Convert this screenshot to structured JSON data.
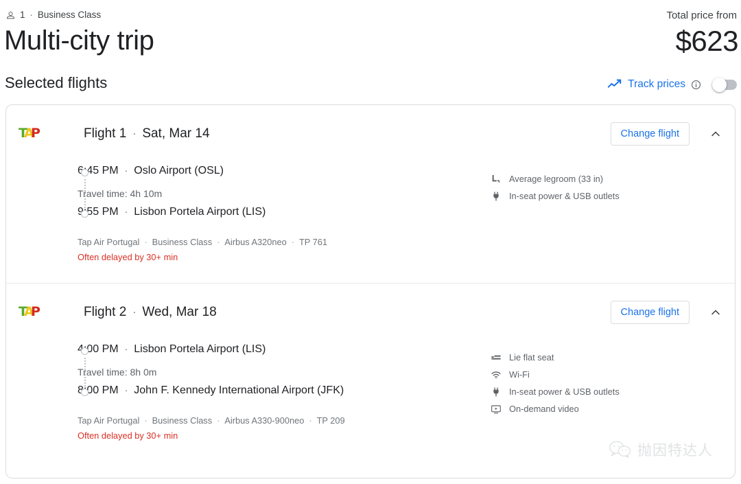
{
  "header": {
    "passenger_icon": "person-icon",
    "passenger_count": "1",
    "separator": "·",
    "cabin_class": "Business Class",
    "title": "Multi-city trip",
    "total_price_label": "Total price from",
    "total_price": "$623"
  },
  "section": {
    "heading": "Selected flights",
    "track_prices": {
      "trend_icon": "trending-up-icon",
      "label": "Track prices",
      "info_icon": "info-icon",
      "toggle_state": "off"
    }
  },
  "colors": {
    "accent_blue": "#1a73e8",
    "warning_red": "#d93025",
    "text_primary": "#202124",
    "text_secondary": "#5f6368",
    "border": "#dadce0",
    "toggle_track": "#bdc1c6",
    "tap_green": "#5aaa2d",
    "tap_yellow": "#f0c419",
    "tap_red": "#d32a1e"
  },
  "flights": [
    {
      "airline_logo": "tap-air-portugal-logo",
      "label": "Flight 1",
      "separator": "·",
      "date": "Sat, Mar 14",
      "change_button": "Change flight",
      "collapse_icon": "chevron-up-icon",
      "departure": {
        "time": "6:45 PM",
        "separator": "·",
        "airport": "Oslo Airport (OSL)"
      },
      "travel_time": "Travel time: 4h 10m",
      "arrival": {
        "time": "9:55 PM",
        "separator": "·",
        "airport": "Lisbon Portela Airport (LIS)"
      },
      "meta": [
        "Tap Air Portugal",
        "Business Class",
        "Airbus A320neo",
        "TP 761"
      ],
      "delay_note": "Often delayed by 30+ min",
      "amenities": [
        {
          "icon": "legroom-icon",
          "label": "Average legroom (33 in)"
        },
        {
          "icon": "power-plug-icon",
          "label": "In-seat power & USB outlets"
        }
      ]
    },
    {
      "airline_logo": "tap-air-portugal-logo",
      "label": "Flight 2",
      "separator": "·",
      "date": "Wed, Mar 18",
      "change_button": "Change flight",
      "collapse_icon": "chevron-up-icon",
      "departure": {
        "time": "4:00 PM",
        "separator": "·",
        "airport": "Lisbon Portela Airport (LIS)"
      },
      "travel_time": "Travel time: 8h 0m",
      "arrival": {
        "time": "8:00 PM",
        "separator": "·",
        "airport": "John F. Kennedy International Airport (JFK)"
      },
      "meta": [
        "Tap Air Portugal",
        "Business Class",
        "Airbus A330-900neo",
        "TP 209"
      ],
      "delay_note": "Often delayed by 30+ min",
      "amenities": [
        {
          "icon": "lie-flat-seat-icon",
          "label": "Lie flat seat"
        },
        {
          "icon": "wifi-icon",
          "label": "Wi-Fi"
        },
        {
          "icon": "power-plug-icon",
          "label": "In-seat power & USB outlets"
        },
        {
          "icon": "on-demand-video-icon",
          "label": "On-demand video"
        }
      ]
    }
  ],
  "watermark": {
    "icon": "wechat-icon",
    "text": "抛因特达人"
  }
}
